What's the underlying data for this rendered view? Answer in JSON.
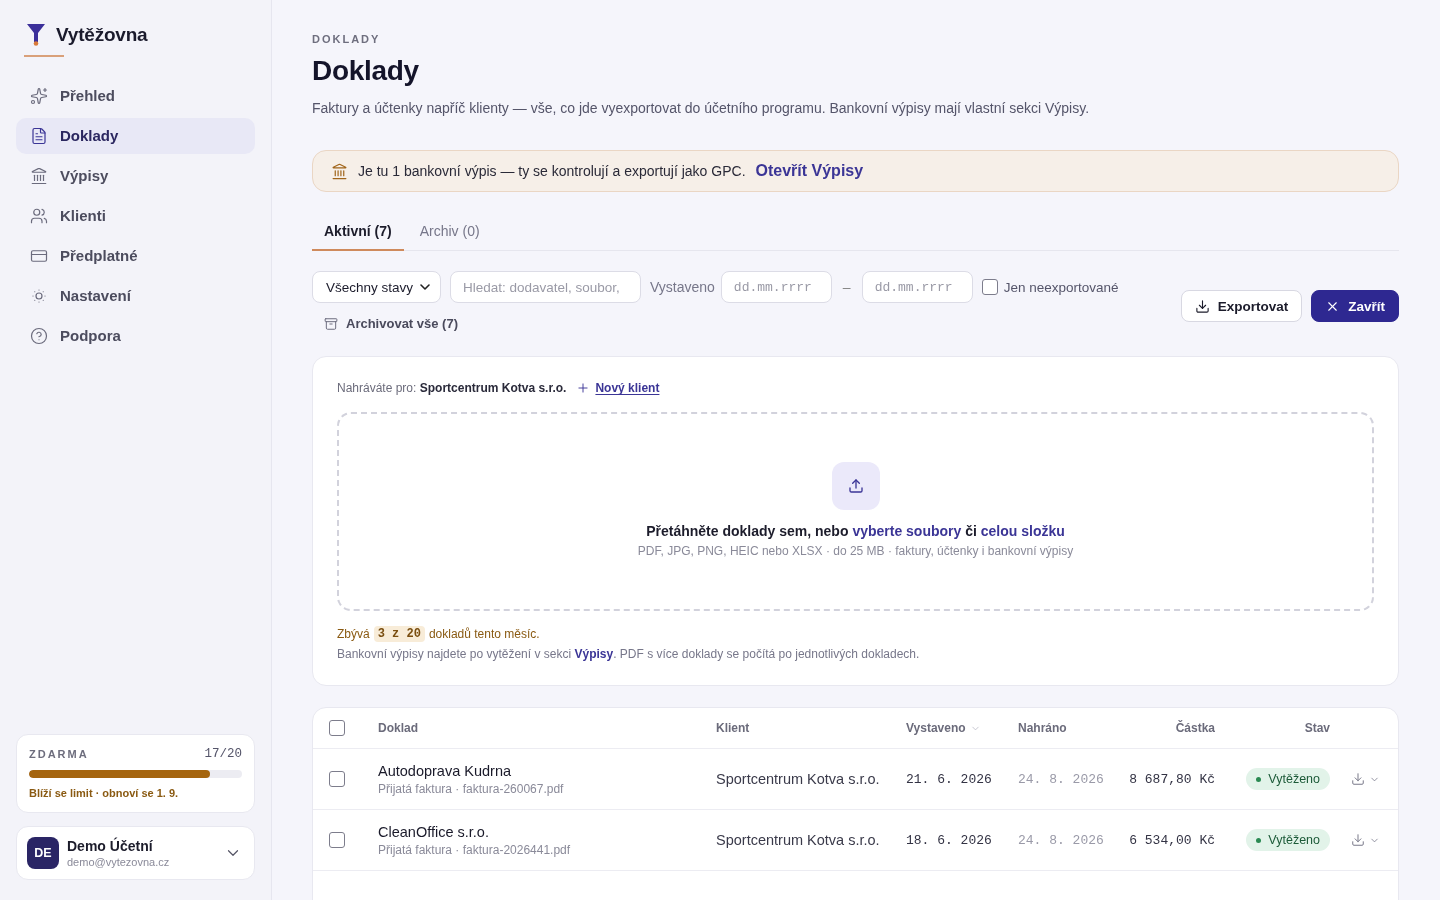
{
  "sidebar": {
    "brand": "Vytěžovna",
    "nav": [
      {
        "kind": "overview",
        "label": "Přehled",
        "selected": false
      },
      {
        "kind": "documents",
        "label": "Doklady",
        "selected": true
      },
      {
        "kind": "statements",
        "label": "Výpisy",
        "selected": false
      },
      {
        "kind": "clients",
        "label": "Klienti",
        "selected": false
      },
      {
        "kind": "subscription",
        "label": "Předplatné",
        "selected": false
      },
      {
        "kind": "settings",
        "label": "Nastavení",
        "selected": false
      },
      {
        "kind": "support",
        "label": "Podpora",
        "selected": false
      }
    ],
    "plan": {
      "name": "ZDARMA",
      "usage": "17/20",
      "level": 0.85,
      "note": "Blíží se limit · obnoví se 1. 9."
    },
    "user": {
      "initials": "DE",
      "name": "Demo Účetní",
      "email": "demo@vytezovna.cz"
    }
  },
  "header": {
    "eyebrow": "DOKLADY",
    "title": "Doklady",
    "description": "Faktury a účtenky napříč klienty — vše, co jde vyexportovat do účetního programu. Bankovní výpisy mají vlastní sekci Výpisy."
  },
  "banner": {
    "text": "Je tu 1 bankovní výpis — ty se kontrolují a exportují jako GPC.",
    "link": "Otevřít Výpisy"
  },
  "tabs": [
    {
      "label": "Aktivní (7)",
      "selected": true
    },
    {
      "label": "Archiv (0)",
      "selected": false
    }
  ],
  "filters": {
    "status": {
      "value": "Všechny stavy"
    },
    "search": {
      "placeholder": "Hledat: dodavatel, soubor,"
    },
    "date_label": "Vystaveno",
    "date_from": {
      "placeholder": "dd.mm.rrrr"
    },
    "date_separator": "–",
    "date_to": {
      "placeholder": "dd.mm.rrrr"
    },
    "unexported_only": {
      "label": "Jen neexportované",
      "checked": false
    },
    "archive_all": "Archivovat vše (7)"
  },
  "actions": [
    {
      "kind": "export",
      "label": "Exportovat"
    },
    {
      "kind": "close",
      "label": "Zavřít"
    }
  ],
  "upload": {
    "client_line": "Nahráváte pro: **Sportcentrum Kotva s.r.o.**",
    "new_client": "Nový klient",
    "drop_text": "Přetáhněte doklady sem, nebo",
    "choose_files": "vyberte soubory",
    "conjunction": "či",
    "choose_folder": "celou složku",
    "hint": "PDF, JPG, PNG, HEIC nebo XLSX · do 25 MB · faktury, účtenky i bankovní výpisy",
    "quota_before": "Zbývá",
    "quota": "3 z 20",
    "quota_after": "dokladů tento měsíc.",
    "note_before": "Bankovní výpisy najdete po vytěžení v sekci",
    "note_link": "Výpisy",
    "note_after": ". PDF s více doklady se počítá po jednotlivých dokladech."
  },
  "table": {
    "select_all": {
      "checked": false
    },
    "columns": [
      {
        "label": "Doklad",
        "sorted": false
      },
      {
        "label": "Klient",
        "sorted": false
      },
      {
        "label": "Vystaveno",
        "sorted": true
      },
      {
        "label": "Nahráno",
        "sorted": false
      },
      {
        "label": "Částka",
        "sorted": false
      },
      {
        "label": "Stav",
        "sorted": false
      }
    ],
    "rows": [
      {
        "selected": false,
        "name": "Autodoprava Kudrna",
        "detail": "Přijatá faktura · faktura-260067.pdf",
        "client": "Sportcentrum Kotva s.r.o.",
        "issued": "21. 6. 2026",
        "uploaded": "24. 8. 2026",
        "amount": "8 687,80 Kč",
        "status": {
          "kind": "extracted",
          "label": "Vytěženo"
        }
      },
      {
        "selected": false,
        "name": "CleanOffice s.r.o.",
        "detail": "Přijatá faktura · faktura-2026441.pdf",
        "client": "Sportcentrum Kotva s.r.o.",
        "issued": "18. 6. 2026",
        "uploaded": "24. 8. 2026",
        "amount": "6 534,00 Kč",
        "status": {
          "kind": "extracted",
          "label": "Vytěženo"
        }
      }
    ]
  }
}
